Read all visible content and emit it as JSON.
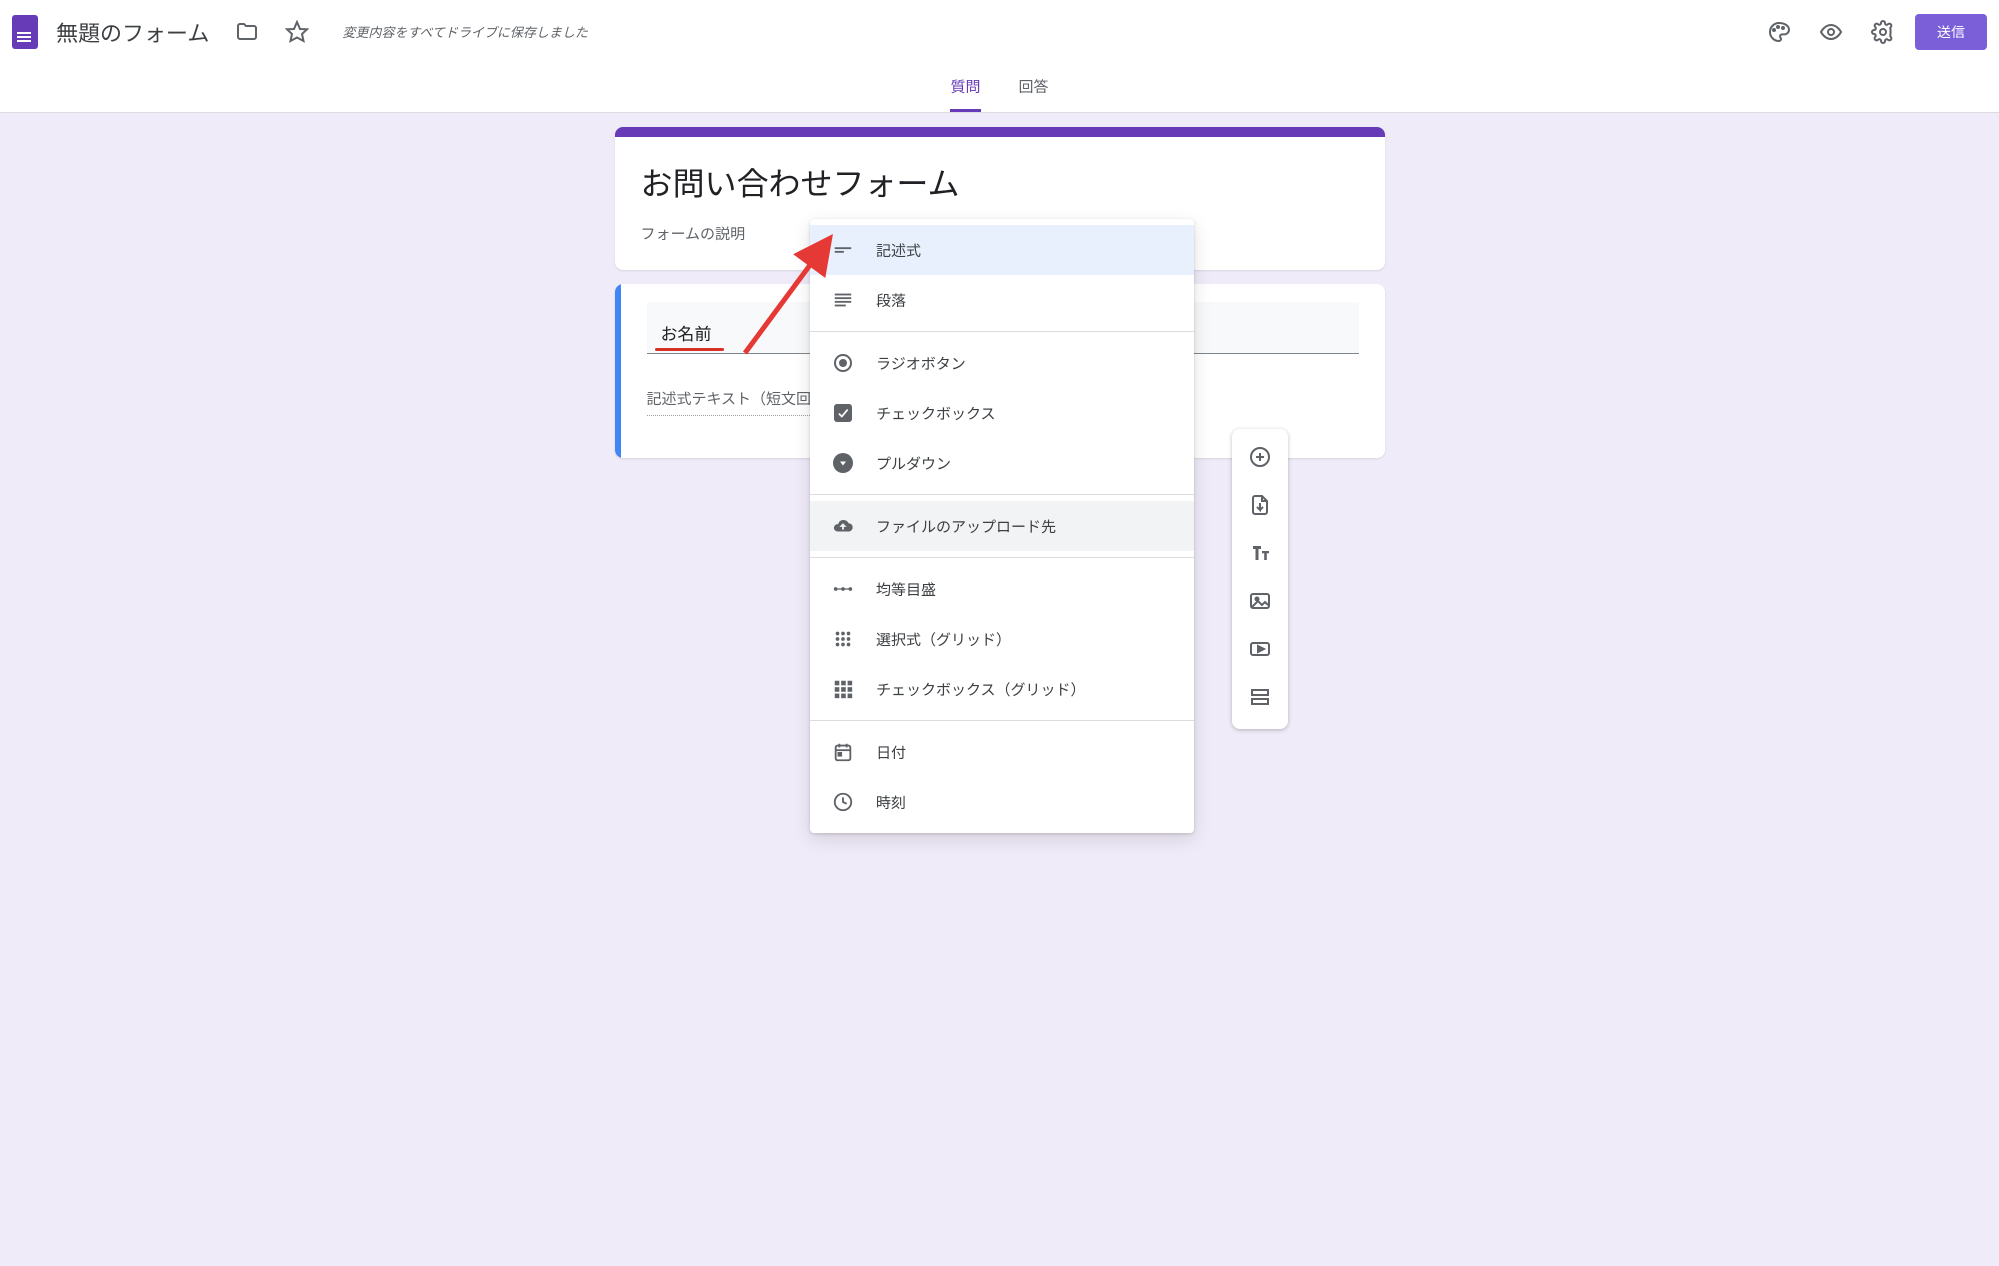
{
  "header": {
    "doc_title": "無題のフォーム",
    "save_message": "変更内容をすべてドライブに保存しました",
    "send": "送信"
  },
  "tabs": {
    "questions": "質問",
    "responses": "回答"
  },
  "form": {
    "title": "お問い合わせフォーム",
    "description": "フォームの説明",
    "question_title": "お名前",
    "answer_placeholder": "記述式テキスト（短文回答）"
  },
  "question_types": {
    "short_answer": "記述式",
    "paragraph": "段落",
    "radio": "ラジオボタン",
    "checkbox": "チェックボックス",
    "dropdown": "プルダウン",
    "file_upload": "ファイルのアップロード先",
    "linear_scale": "均等目盛",
    "grid_radio": "選択式（グリッド）",
    "grid_checkbox": "チェックボックス（グリッド）",
    "date": "日付",
    "time": "時刻"
  }
}
